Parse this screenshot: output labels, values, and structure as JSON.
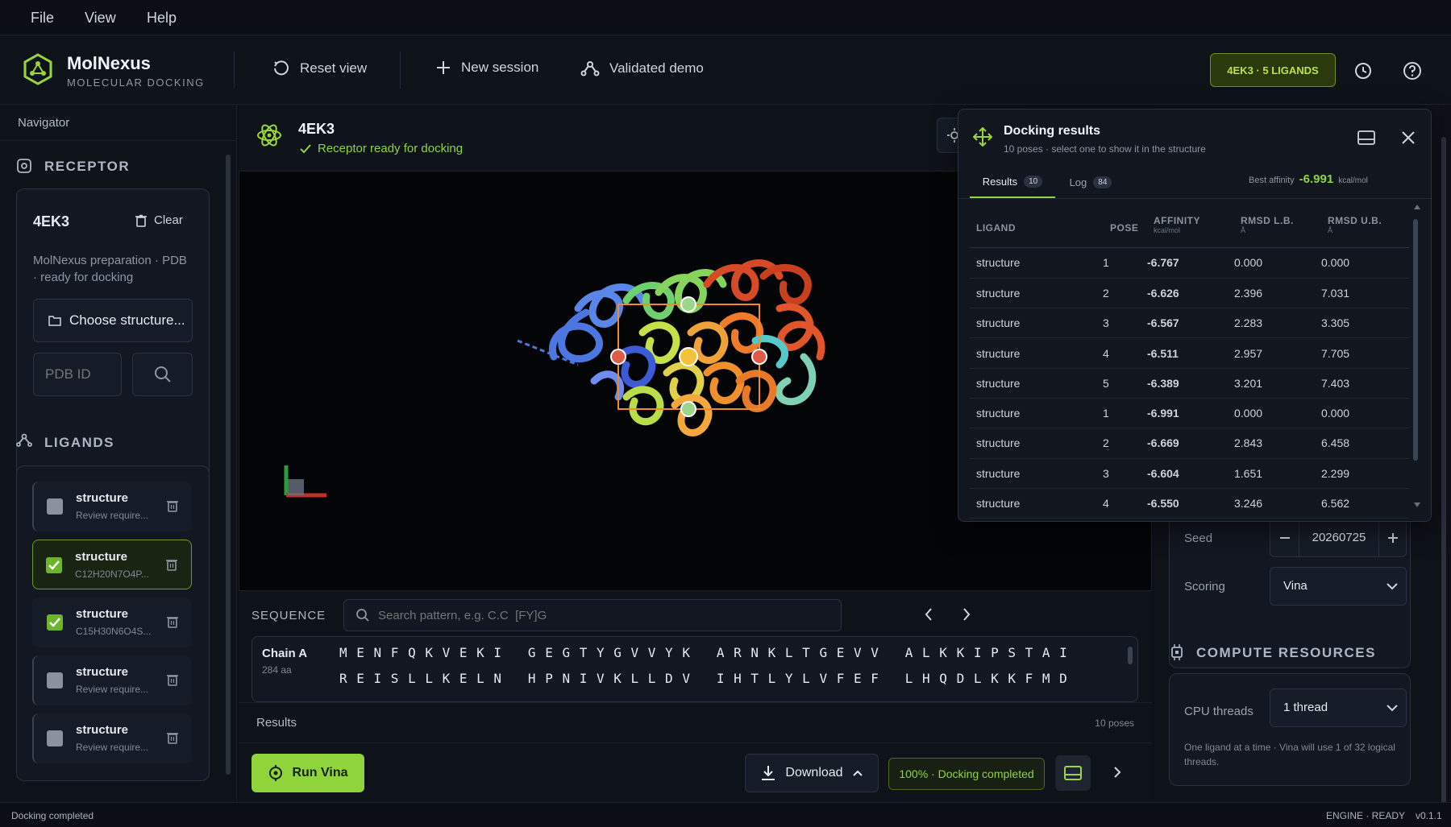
{
  "menu": {
    "file": "File",
    "view": "View",
    "help": "Help"
  },
  "brand": {
    "name": "MolNexus",
    "tagline": "MOLECULAR DOCKING"
  },
  "header": {
    "reset": "Reset view",
    "new_session": "New session",
    "demo": "Validated demo",
    "badge": "4EK3 · 5 LIGANDS"
  },
  "colors": {
    "accent": "#9ad63a",
    "background": "#0d1017",
    "success": "#8fd43a"
  },
  "sidebar": {
    "navigator": "Navigator",
    "receptor_title": "RECEPTOR",
    "receptor": {
      "id": "4EK3",
      "clear": "Clear",
      "desc_line1": "MolNexus preparation · PDB",
      "desc_line2": "· ready for docking",
      "choose": "Choose structure...",
      "pdb_placeholder": "PDB ID"
    },
    "ligands_title": "LIGANDS",
    "ligands": [
      {
        "name": "structure",
        "sub": "Review require..."
      },
      {
        "name": "structure",
        "sub": "C12H20N7O4P..."
      },
      {
        "name": "structure",
        "sub": "C15H30N6O4S..."
      },
      {
        "name": "structure",
        "sub": "Review require..."
      },
      {
        "name": "structure",
        "sub": "Review require..."
      }
    ]
  },
  "viewer": {
    "title": "4EK3",
    "status": "Receptor ready for docking"
  },
  "sequence": {
    "label": "SEQUENCE",
    "search_placeholder": "Search pattern, e.g. C.C  [FY]G",
    "chain": "Chain A",
    "length": "284 aa",
    "row1": "M E N F Q K V E K I   G E G T Y G V V Y K   A R N K L T G E V V   A L K K I P S T A I",
    "row2": "R E I S L L K E L N   H P N I V K L L D V   I H T L Y L V F E F   L H Q D L K K F M D"
  },
  "results_strip": {
    "label": "Results",
    "count": "10 poses"
  },
  "bottom": {
    "run": "Run Vina",
    "download": "Download",
    "progress": "100% · Docking completed"
  },
  "dock": {
    "title": "Docking results",
    "subtitle": "10 poses · select one to show it in the structure",
    "tab_results": "Results",
    "tab_results_count": "10",
    "tab_log": "Log",
    "tab_log_count": "84",
    "best_label": "Best affinity",
    "best_value": "-6.991",
    "best_unit": "kcal/mol",
    "columns": {
      "ligand": "LIGAND",
      "pose": "POSE",
      "affinity": "AFFINITY",
      "affinity_unit": "kcal/mol",
      "rmsd_lb": "RMSD L.B.",
      "rmsd_ub": "RMSD U.B.",
      "unit_a": "Å"
    },
    "rows": [
      {
        "ligand": "structure",
        "pose": "1",
        "affinity": "-6.767",
        "lb": "0.000",
        "ub": "0.000"
      },
      {
        "ligand": "structure",
        "pose": "2",
        "affinity": "-6.626",
        "lb": "2.396",
        "ub": "7.031"
      },
      {
        "ligand": "structure",
        "pose": "3",
        "affinity": "-6.567",
        "lb": "2.283",
        "ub": "3.305"
      },
      {
        "ligand": "structure",
        "pose": "4",
        "affinity": "-6.511",
        "lb": "2.957",
        "ub": "7.705"
      },
      {
        "ligand": "structure",
        "pose": "5",
        "affinity": "-6.389",
        "lb": "3.201",
        "ub": "7.403"
      },
      {
        "ligand": "structure",
        "pose": "1",
        "affinity": "-6.991",
        "lb": "0.000",
        "ub": "0.000"
      },
      {
        "ligand": "structure",
        "pose": "2",
        "affinity": "-6.669",
        "lb": "2.843",
        "ub": "6.458"
      },
      {
        "ligand": "structure",
        "pose": "3",
        "affinity": "-6.604",
        "lb": "1.651",
        "ub": "2.299"
      },
      {
        "ligand": "structure",
        "pose": "4",
        "affinity": "-6.550",
        "lb": "3.246",
        "ub": "6.562"
      }
    ]
  },
  "right": {
    "seed_label": "Seed",
    "seed_value": "20260725",
    "scoring_label": "Scoring",
    "scoring_value": "Vina",
    "compute_title": "COMPUTE RESOURCES",
    "cpu_label": "CPU threads",
    "cpu_value": "1 thread",
    "cpu_note_line1": "One ligand at a time · Vina will use 1 of 32 logical",
    "cpu_note_line2": "threads."
  },
  "status": {
    "left": "Docking completed",
    "engine": "ENGINE · READY",
    "version": "v0.1.1"
  }
}
